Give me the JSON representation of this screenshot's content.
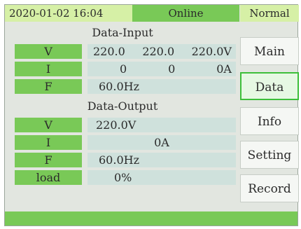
{
  "header": {
    "datetime": "2020-01-02 16:04",
    "status": "Online",
    "mode": "Normal"
  },
  "input": {
    "title": "Data-Input",
    "rows": [
      {
        "label": "V",
        "values": [
          "220.0",
          "220.0",
          "220.0V"
        ]
      },
      {
        "label": "I",
        "values": [
          "0",
          "0",
          "0A"
        ]
      },
      {
        "label": "F",
        "value": "60.0Hz"
      }
    ]
  },
  "output": {
    "title": "Data-Output",
    "rows": [
      {
        "label": "V",
        "value": "220.0V"
      },
      {
        "label": "I",
        "value": "0A"
      },
      {
        "label": "F",
        "value": "60.0Hz"
      },
      {
        "label": "load",
        "value": "0%"
      }
    ]
  },
  "nav": {
    "items": [
      "Main",
      "Data",
      "Info",
      "Setting",
      "Record"
    ],
    "active": "Data"
  },
  "colors": {
    "accent_green": "#79c957",
    "light_green": "#d6f0a6",
    "value_bg": "#cfe1dc",
    "active_border": "#3dbf3a"
  }
}
